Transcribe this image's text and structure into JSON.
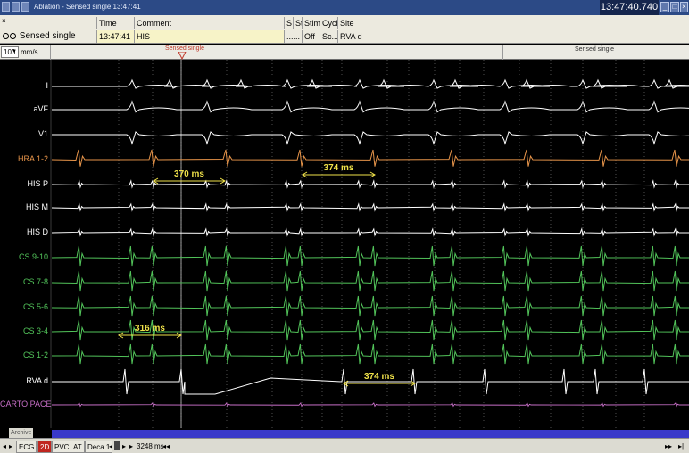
{
  "window": {
    "title": "Ablation - Sensed single  13:47:41",
    "clock": "13:47:40.740"
  },
  "info_panel": {
    "event_name": "Sensed single",
    "headers": {
      "time": "Time",
      "comment": "Comment",
      "s": "S",
      "st": "St",
      "stim": "Stim",
      "cycle": "Cycle",
      "site": "Site"
    },
    "values": {
      "time": "13:47:41",
      "comment": "HIS",
      "s": "......",
      "st": "",
      "stim": "Off",
      "cycle": "Sc...",
      "site": "RVA d"
    }
  },
  "speed": {
    "value": "100",
    "unit": "mm/s"
  },
  "markers": {
    "left": "Sensed single",
    "right": "Sensed single"
  },
  "leads": [
    {
      "label": "I",
      "color": "#ffffff"
    },
    {
      "label": "aVF",
      "color": "#ffffff"
    },
    {
      "label": "V1",
      "color": "#ffffff"
    },
    {
      "label": "HRA 1-2",
      "color": "#e8954a"
    },
    {
      "label": "HIS P",
      "color": "#ffffff"
    },
    {
      "label": "HIS M",
      "color": "#ffffff"
    },
    {
      "label": "HIS D",
      "color": "#ffffff"
    },
    {
      "label": "CS 9-10",
      "color": "#52c45a"
    },
    {
      "label": "CS 7-8",
      "color": "#52c45a"
    },
    {
      "label": "CS 5-6",
      "color": "#52c45a"
    },
    {
      "label": "CS 3-4",
      "color": "#52c45a"
    },
    {
      "label": "CS 1-2",
      "color": "#52c45a"
    },
    {
      "label": "RVA d",
      "color": "#ffffff"
    },
    {
      "label": "CARTO PACE",
      "color": "#c86fc8"
    }
  ],
  "measurements": [
    {
      "label": "370 ms"
    },
    {
      "label": "374 ms"
    },
    {
      "label": "316 ms"
    },
    {
      "label": "374 ms"
    }
  ],
  "bottom": {
    "archive": "Archive",
    "tabs": [
      "ECG",
      "2D",
      "PVC",
      "AT",
      "Deca 1"
    ],
    "time_window": "3248 ms"
  },
  "colors": {
    "titlebar": "#2c4a86",
    "caliper": "#f0e24a",
    "scroll": "#3939c9",
    "active_tab": "#c0261f"
  }
}
